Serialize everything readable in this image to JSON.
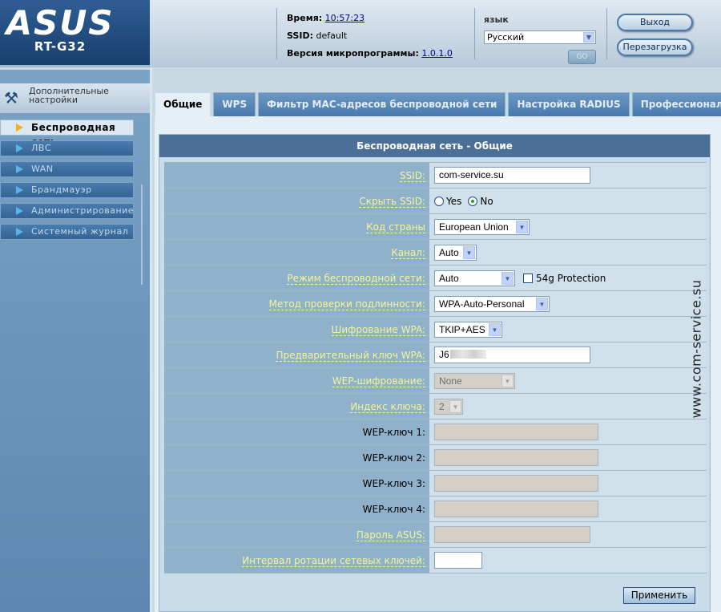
{
  "brand": {
    "logo": "ASUS",
    "model": "RT-G32"
  },
  "header": {
    "time_label": "Время:",
    "time_value": "10:57:23",
    "ssid_label": "SSID:",
    "ssid_value": "default",
    "firmware_label": "Версия микропрограммы:",
    "firmware_value": "1.0.1.0",
    "language_label": "язык",
    "language_selected": "Русский",
    "go_button": "GO",
    "logout_button": "Выход",
    "reboot_button": "Перезагрузка"
  },
  "sidebar": {
    "advanced_label": "Дополнительные настройки",
    "items": [
      {
        "label": "Беспроводная сеть",
        "active": true
      },
      {
        "label": "ЛВС"
      },
      {
        "label": "WAN"
      },
      {
        "label": "Брандмауэр"
      },
      {
        "label": "Администрирование"
      },
      {
        "label": "Системный журнал"
      }
    ]
  },
  "tabs": [
    {
      "label": "Общие",
      "active": true
    },
    {
      "label": "WPS"
    },
    {
      "label": "Фильтр MAC-адресов беспроводной сети"
    },
    {
      "label": "Настройка RADIUS"
    },
    {
      "label": "Профессионально"
    }
  ],
  "form": {
    "title": "Беспроводная сеть - Общие",
    "ssid": {
      "label": "SSID:",
      "value": "com-service.su"
    },
    "hide_ssid": {
      "label": "Скрыть SSID:",
      "yes": "Yes",
      "no": "No",
      "selected": "No"
    },
    "country": {
      "label": "Код страны",
      "value": "European Union"
    },
    "channel": {
      "label": "Канал:",
      "value": "Auto"
    },
    "mode": {
      "label": "Режим беспроводной сети:",
      "value": "Auto",
      "protection_label": "54g Protection",
      "protection_checked": false
    },
    "auth": {
      "label": "Метод проверки подлинности:",
      "value": "WPA-Auto-Personal"
    },
    "wpa_enc": {
      "label": "Шифрование WPA:",
      "value": "TKIP+AES"
    },
    "psk": {
      "label": "Предварительный ключ WPA:",
      "value": "J6"
    },
    "wep_enc": {
      "label": "WEP-шифрование:",
      "value": "None"
    },
    "key_index": {
      "label": "Индекс ключа:",
      "value": "2"
    },
    "wep1": {
      "label": "WEP-ключ 1:",
      "value": ""
    },
    "wep2": {
      "label": "WEP-ключ 2:",
      "value": ""
    },
    "wep3": {
      "label": "WEP-ключ 3:",
      "value": ""
    },
    "wep4": {
      "label": "WEP-ключ 4:",
      "value": ""
    },
    "asus_pass": {
      "label": "Пароль ASUS:",
      "value": ""
    },
    "rotation": {
      "label": "Интервал ротации сетевых ключей:",
      "value": ""
    },
    "apply_button": "Применить"
  },
  "watermark": "www.com-service.su",
  "colors": {
    "sidebar": "#5d88b1",
    "form_label_bg": "#8fb1c9",
    "label_text": "#f3f59a",
    "title_bar": "#4b6f96"
  }
}
